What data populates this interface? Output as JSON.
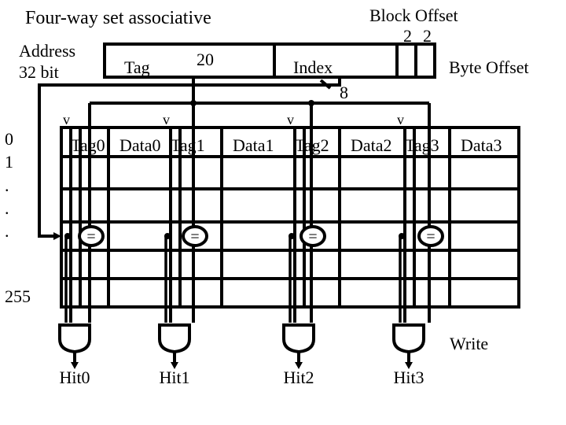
{
  "title": "Four-way set associative",
  "address": {
    "label_line1": "Address",
    "label_line2": "32 bit",
    "fields": [
      {
        "name": "Tag",
        "bits": "20"
      },
      {
        "name": "Index",
        "bits": "8"
      },
      {
        "name": "Block Offset",
        "bits": "2"
      },
      {
        "name": "Byte Offset",
        "bits": "2"
      }
    ]
  },
  "rows": {
    "labels": [
      "0",
      "1",
      ".",
      ".",
      "."
    ],
    "last_label": "255"
  },
  "ways": [
    {
      "valid": "v",
      "tag": "Tag0",
      "data": "Data0",
      "compare": "=",
      "hit": "Hit0"
    },
    {
      "valid": "v",
      "tag": "Tag1",
      "data": "Data1",
      "compare": "=",
      "hit": "Hit1"
    },
    {
      "valid": "v",
      "tag": "Tag2",
      "data": "Data2",
      "compare": "=",
      "hit": "Hit2"
    },
    {
      "valid": "v",
      "tag": "Tag3",
      "data": "Data3",
      "compare": "=",
      "hit": "Hit3"
    }
  ],
  "write_label": "Write"
}
